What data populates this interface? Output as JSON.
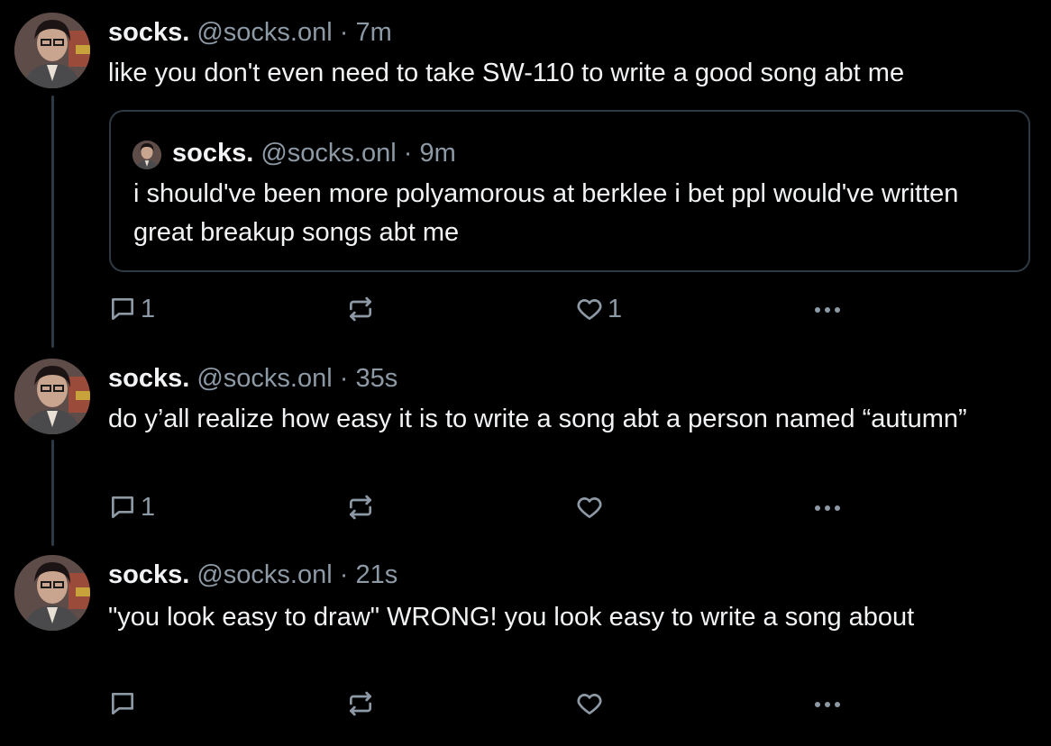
{
  "colors": {
    "background": "#000000",
    "text": "#f1f3f5",
    "muted": "#8d99a5",
    "border": "#2e3943"
  },
  "separator": "·",
  "posts": [
    {
      "author": "socks.",
      "handle": "@socks.onl",
      "time": "7m",
      "text": "like you don't even need to take SW-110 to write a good song abt me",
      "quote": {
        "author": "socks.",
        "handle": "@socks.onl",
        "time": "9m",
        "text": "i should've been more polyamorous at berklee i bet ppl would've written great breakup songs abt me"
      },
      "reply_count": "1",
      "repost_count": "",
      "like_count": "1"
    },
    {
      "author": "socks.",
      "handle": "@socks.onl",
      "time": "35s",
      "text": "do y’all realize how easy it is to write a song abt a person named “autumn”",
      "reply_count": "1",
      "repost_count": "",
      "like_count": ""
    },
    {
      "author": "socks.",
      "handle": "@socks.onl",
      "time": "21s",
      "text": "\"you look easy to draw\" WRONG! you look easy to write a song about",
      "reply_count": "",
      "repost_count": "",
      "like_count": ""
    }
  ],
  "icons": {
    "reply": "reply-bubble-icon",
    "repost": "repost-arrows-icon",
    "like": "heart-icon",
    "more": "ellipsis-icon",
    "avatar": "profile-photo"
  }
}
